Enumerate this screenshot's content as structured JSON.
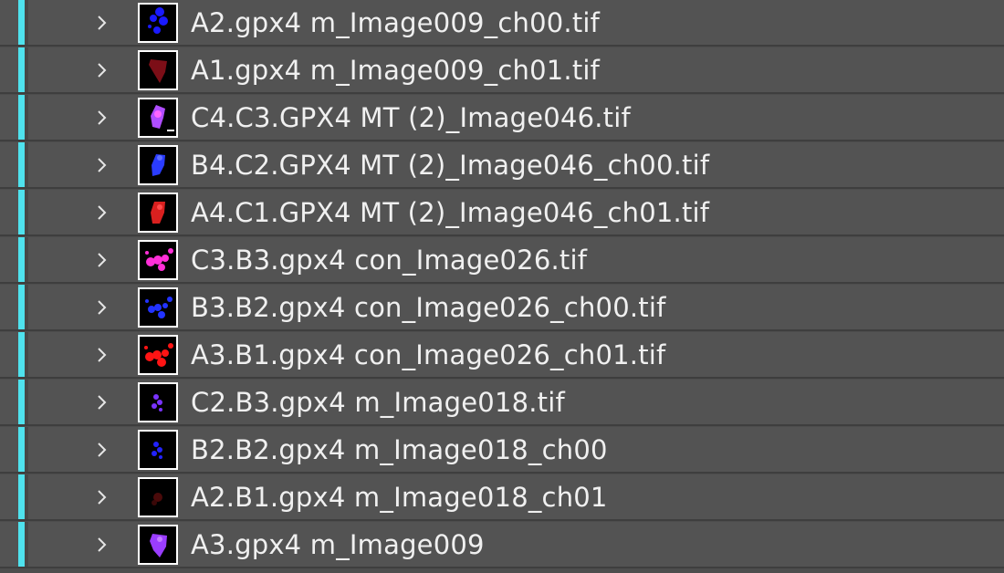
{
  "layers": [
    {
      "name": "A2.gpx4 m_Image009_ch00.tif",
      "label_color": "#4fe2ee",
      "thumb_color": "#1a1aff",
      "thumb_kind": "blue-cells"
    },
    {
      "name": "A1.gpx4 m_Image009_ch01.tif",
      "label_color": "#4fe2ee",
      "thumb_color": "#8a0f1a",
      "thumb_kind": "red-cells-dim"
    },
    {
      "name": "C4.C3.GPX4 MT (2)_Image046.tif",
      "label_color": "#4fe2ee",
      "thumb_color": "#b04dff",
      "thumb_kind": "merged-cells"
    },
    {
      "name": "B4.C2.GPX4 MT (2)_Image046_ch00.tif",
      "label_color": "#4fe2ee",
      "thumb_color": "#2a3cff",
      "thumb_kind": "blue-cells"
    },
    {
      "name": "A4.C1.GPX4 MT (2)_Image046_ch01.tif",
      "label_color": "#4fe2ee",
      "thumb_color": "#d9201f",
      "thumb_kind": "red-cells"
    },
    {
      "name": "C3.B3.gpx4 con_Image026.tif",
      "label_color": "#4fe2ee",
      "thumb_color": "#ff2fd8",
      "thumb_kind": "merged-cells"
    },
    {
      "name": "B3.B2.gpx4 con_Image026_ch00.tif",
      "label_color": "#4fe2ee",
      "thumb_color": "#2233ff",
      "thumb_kind": "blue-cells"
    },
    {
      "name": "A3.B1.gpx4 con_Image026_ch01.tif",
      "label_color": "#4fe2ee",
      "thumb_color": "#ff1414",
      "thumb_kind": "red-cells"
    },
    {
      "name": "C2.B3.gpx4 m_Image018.tif",
      "label_color": "#4fe2ee",
      "thumb_color": "#7a33ff",
      "thumb_kind": "small-cells"
    },
    {
      "name": "B2.B2.gpx4 m_Image018_ch00",
      "label_color": "#4fe2ee",
      "thumb_color": "#2222ff",
      "thumb_kind": "small-cells"
    },
    {
      "name": "A2.B1.gpx4 m_Image018_ch01",
      "label_color": "#4fe2ee",
      "thumb_color": "#4a0a0a",
      "thumb_kind": "red-cells-dim"
    },
    {
      "name": "A3.gpx4 m_Image009",
      "label_color": "#4fe2ee",
      "thumb_color": "#9a3dff",
      "thumb_kind": "merged-cells"
    }
  ],
  "icons": {
    "twirl": "chevron-right-icon",
    "thumbnail": "layer-thumbnail-icon"
  }
}
